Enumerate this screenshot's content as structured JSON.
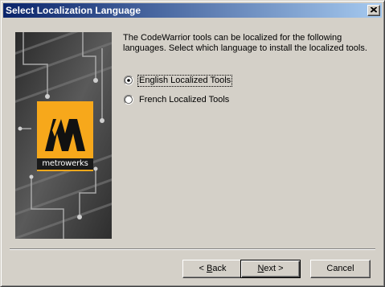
{
  "window": {
    "title": "Select Localization Language"
  },
  "banner": {
    "logo_text": "metrowerks"
  },
  "description": "The CodeWarrior tools can be localized for the following\nlanguages.  Select which language to install the localized tools.",
  "options": [
    {
      "label": "English Localized Tools",
      "selected": true
    },
    {
      "label": "French Localized Tools",
      "selected": false
    }
  ],
  "buttons": {
    "back": {
      "prefix": "< ",
      "mnemonic": "B",
      "rest": "ack"
    },
    "next": {
      "mnemonic": "N",
      "rest": "ext >"
    },
    "cancel": "Cancel"
  },
  "colors": {
    "title_start": "#0a246a",
    "title_end": "#a6caf0",
    "logo_orange": "#f7a81b",
    "face": "#d4d0c8"
  },
  "icons": {
    "close": "close-icon",
    "logo": "metrowerks-logo-icon"
  }
}
